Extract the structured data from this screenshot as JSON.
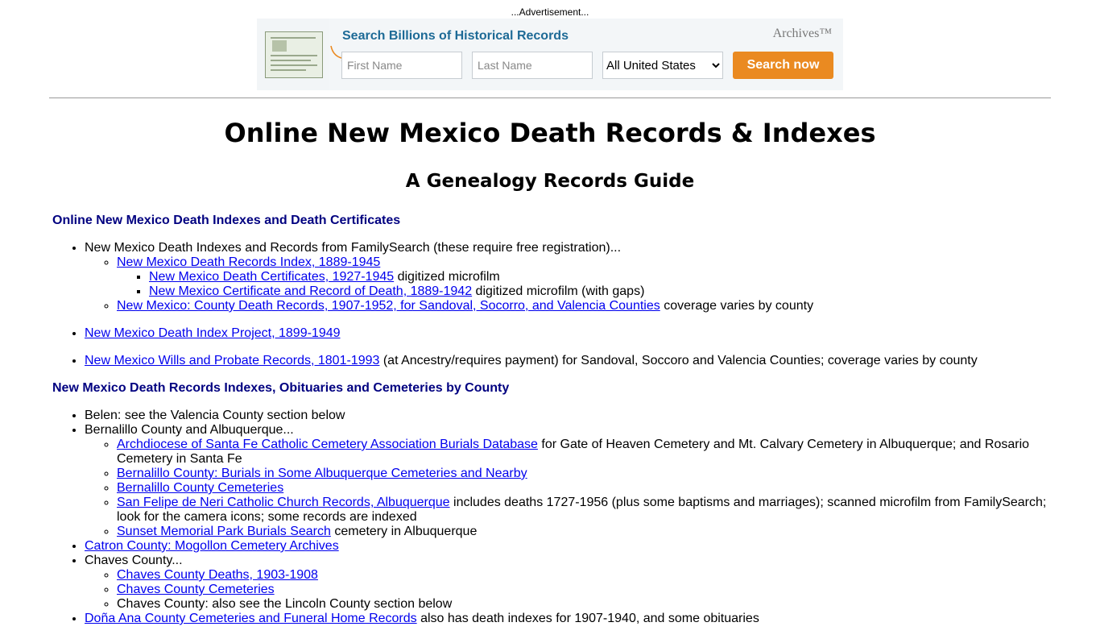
{
  "ad": {
    "label": "...Advertisement...",
    "title": "Search Billions of Historical Records",
    "brand": "Archives™",
    "first_name_placeholder": "First Name",
    "last_name_placeholder": "Last Name",
    "location_selected": "All United States",
    "button": "Search now",
    "accent_color": "#ea8a21",
    "title_color": "#1d6a96"
  },
  "page": {
    "title": "Online New Mexico Death Records & Indexes",
    "subtitle": "A Genealogy Records Guide"
  },
  "section1": {
    "heading": "Online New Mexico Death Indexes and Death Certificates",
    "fs_intro": "New Mexico Death Indexes and Records from FamilySearch (these require free registration)...",
    "fs_link1": "New Mexico Death Records Index, 1889-1945",
    "fs_sub1_link": "New Mexico Death Certificates, 1927-1945",
    "fs_sub1_text": " digitized microfilm",
    "fs_sub2_link": "New Mexico Certificate and Record of Death, 1889-1942",
    "fs_sub2_text": " digitized microfilm (with gaps)",
    "fs_link2": "New Mexico: County Death Records, 1907-1952, for Sandoval, Socorro, and Valencia Counties",
    "fs_link2_text": " coverage varies by county",
    "project_link": "New Mexico Death Index Project, 1899-1949",
    "wills_link": "New Mexico Wills and Probate Records, 1801-1993",
    "wills_text": " (at Ancestry/requires payment) for Sandoval, Soccoro and Valencia Counties; coverage varies by county"
  },
  "section2": {
    "heading": "New Mexico Death Records Indexes, Obituaries and Cemeteries by County",
    "belen": "Belen: see the Valencia County section below",
    "bernalillo": "Bernalillo County and Albuquerque...",
    "bern1_link": "Archdiocese of Santa Fe Catholic Cemetery Association Burials Database",
    "bern1_text": " for Gate of Heaven Cemetery and Mt. Calvary Cemetery in Albuquerque; and Rosario Cemetery in Santa Fe",
    "bern2_link": "Bernalillo County: Burials in Some Albuquerque Cemeteries and Nearby",
    "bern3_link": "Bernalillo County Cemeteries",
    "bern4_link": "San Felipe de Neri Catholic Church Records, Albuquerque",
    "bern4_text": " includes deaths 1727-1956 (plus some baptisms and marriages); scanned microfilm from FamilySearch; look for the camera icons; some records are indexed",
    "bern5_link": "Sunset Memorial Park Burials Search",
    "bern5_text": " cemetery in Albuquerque",
    "catron_link": "Catron County: Mogollon Cemetery Archives",
    "chaves": "Chaves County...",
    "chaves1_link": "Chaves County Deaths, 1903-1908",
    "chaves2_link": "Chaves County Cemeteries",
    "chaves3": "Chaves County: also see the Lincoln County section below",
    "dona_link": "Doña Ana County Cemeteries and Funeral Home Records",
    "dona_text": " also has death indexes for 1907-1940, and some obituaries"
  }
}
